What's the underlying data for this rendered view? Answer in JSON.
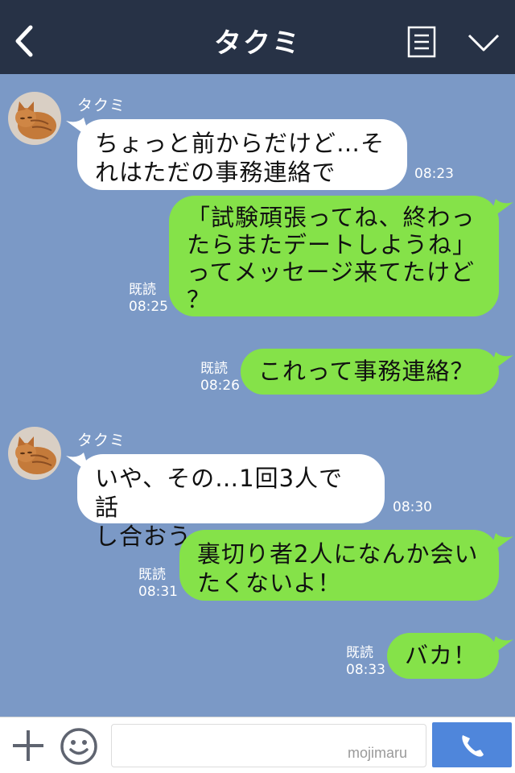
{
  "header": {
    "title": "タクミ"
  },
  "messages": [
    {
      "sender": "タクミ",
      "lines": [
        "ちょっと前からだけど…そ",
        "れはただの事務連絡で"
      ],
      "time": "08:23"
    },
    {
      "lines": [
        "「試験頑張ってね、終わっ",
        "たらまたデートしようね」",
        "ってメッセージ来てたけど",
        "？"
      ],
      "read": "既読",
      "time": "08:25"
    },
    {
      "lines": [
        "これって事務連絡？"
      ],
      "read": "既読",
      "time": "08:26"
    },
    {
      "sender": "タクミ",
      "lines": [
        "いや、その…1回3人で話",
        "し合おう"
      ],
      "time": "08:30"
    },
    {
      "lines": [
        "裏切り者2人になんか会い",
        "たくないよ！"
      ],
      "read": "既読",
      "time": "08:31"
    },
    {
      "lines": [
        "バカ！"
      ],
      "read": "既読",
      "time": "08:33"
    }
  ],
  "footer": {
    "input_value": "",
    "watermark": "mojimaru"
  },
  "colors": {
    "header_bg": "#273246",
    "chat_bg": "#7b99c6",
    "bubble_in": "#ffffff",
    "bubble_out": "#85e249",
    "call_button": "#4f86db"
  },
  "icons": [
    "back-arrow-icon",
    "menu-icon",
    "chevron-down-icon",
    "avatar-cat",
    "plus-icon",
    "emoji-icon",
    "phone-icon"
  ]
}
